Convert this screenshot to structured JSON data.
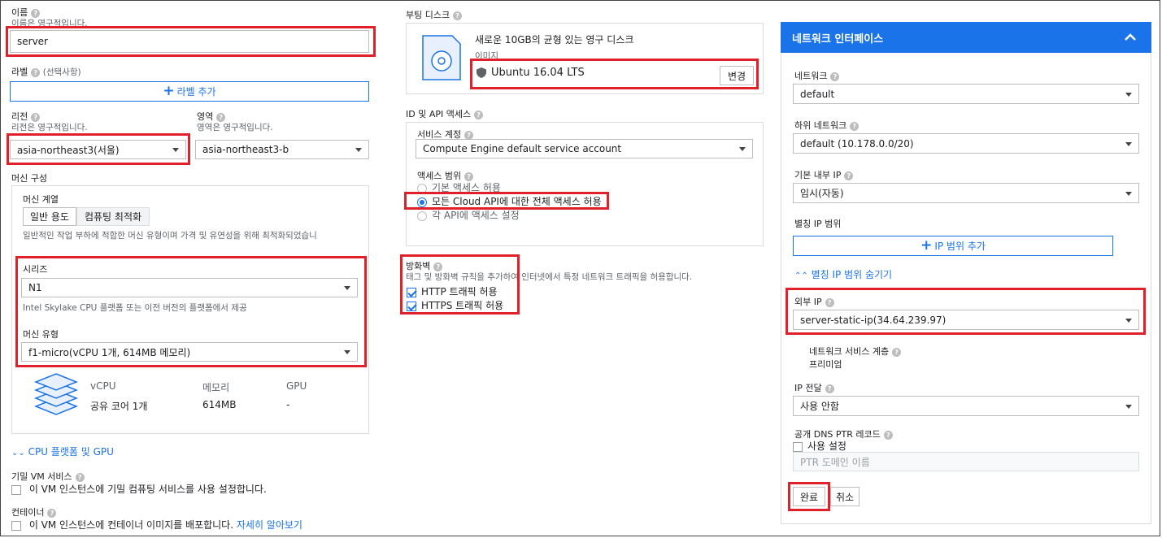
{
  "name": {
    "label": "이름",
    "hint": "이름은 영구적입니다.",
    "value": "server"
  },
  "labels": {
    "label": "라벨",
    "optional": "(선택사항)",
    "add_button": "라벨 추가"
  },
  "region": {
    "label": "리전",
    "hint": "리전은 영구적입니다.",
    "value": "asia-northeast3(서울)"
  },
  "zone": {
    "label": "영역",
    "hint": "영역은 영구적입니다.",
    "value": "asia-northeast3-b"
  },
  "machine_config": {
    "title": "머신 구성",
    "family_label": "머신 계열",
    "tabs": [
      "일반 용도",
      "컴퓨팅 최적화"
    ],
    "family_desc": "일반적인 작업 부하에 적합한 머신 유형이며 가격 및 유연성을 위해 최적화되었습니",
    "series_label": "시리즈",
    "series_value": "N1",
    "series_desc": "Intel Skylake CPU 플랫폼 또는 이전 버전의 플랫폼에서 제공",
    "type_label": "머신 유형",
    "type_value": "f1-micro(vCPU 1개, 614MB 메모리)",
    "spec_headers": [
      "vCPU",
      "메모리",
      "GPU"
    ],
    "spec_values": [
      "공유 코어 1개",
      "614MB",
      "-"
    ],
    "cpu_gpu_link": "CPU 플랫폼 및 GPU"
  },
  "confidential": {
    "label": "기밀 VM 서비스",
    "checkbox": "이 VM 인스턴스에 기밀 컴퓨팅 서비스를 사용 설정합니다."
  },
  "container": {
    "label": "컨테이너",
    "checkbox": "이 VM 인스턴스에 컨테이너 이미지를 배포합니다.",
    "learn_more": "자세히 알아보기"
  },
  "boot_disk": {
    "label": "부팅 디스크",
    "desc": "새로운 10GB의 균형 있는 영구 디스크",
    "image_label": "이미지",
    "image_value": "Ubuntu 16.04 LTS",
    "change_button": "변경"
  },
  "identity": {
    "label": "ID 및 API 액세스",
    "service_account_label": "서비스 계정",
    "service_account_value": "Compute Engine default service account",
    "scope_label": "액세스 범위",
    "scopes": [
      "기본 액세스 허용",
      "모든 Cloud API에 대한 전체 액세스 허용",
      "각 API에 액세스 설정"
    ],
    "selected_scope": 1
  },
  "firewall": {
    "label": "방화벽",
    "desc": "태그 및 방화벽 규칙을 추가하여 인터넷에서 특정 네트워크 트래픽을 허용합니다.",
    "http": "HTTP 트래픽 허용",
    "https": "HTTPS 트래픽 허용"
  },
  "network_panel": {
    "title": "네트워크 인터페이스",
    "network_label": "네트워크",
    "network_value": "default",
    "subnet_label": "하위 네트워크",
    "subnet_value": "default (10.178.0.0/20)",
    "internal_ip_label": "기본 내부 IP",
    "internal_ip_value": "임시(자동)",
    "alias_label": "별칭 IP 범위",
    "alias_add": "IP 범위 추가",
    "alias_hide": "별칭 IP 범위 숨기기",
    "external_ip_label": "외부 IP",
    "external_ip_value": "server-static-ip(34.64.239.97)",
    "tier_label": "네트워크 서비스 계층",
    "tier_value": "프리미엄",
    "forwarding_label": "IP 전달",
    "forwarding_value": "사용 안함",
    "dns_label": "공개 DNS PTR 레코드",
    "dns_checkbox": "사용 설정",
    "dns_placeholder": "PTR 도메인 이름",
    "done_button": "완료",
    "cancel_button": "취소"
  },
  "colors": {
    "accent": "#1a73e8",
    "highlight": "#e0202a"
  }
}
